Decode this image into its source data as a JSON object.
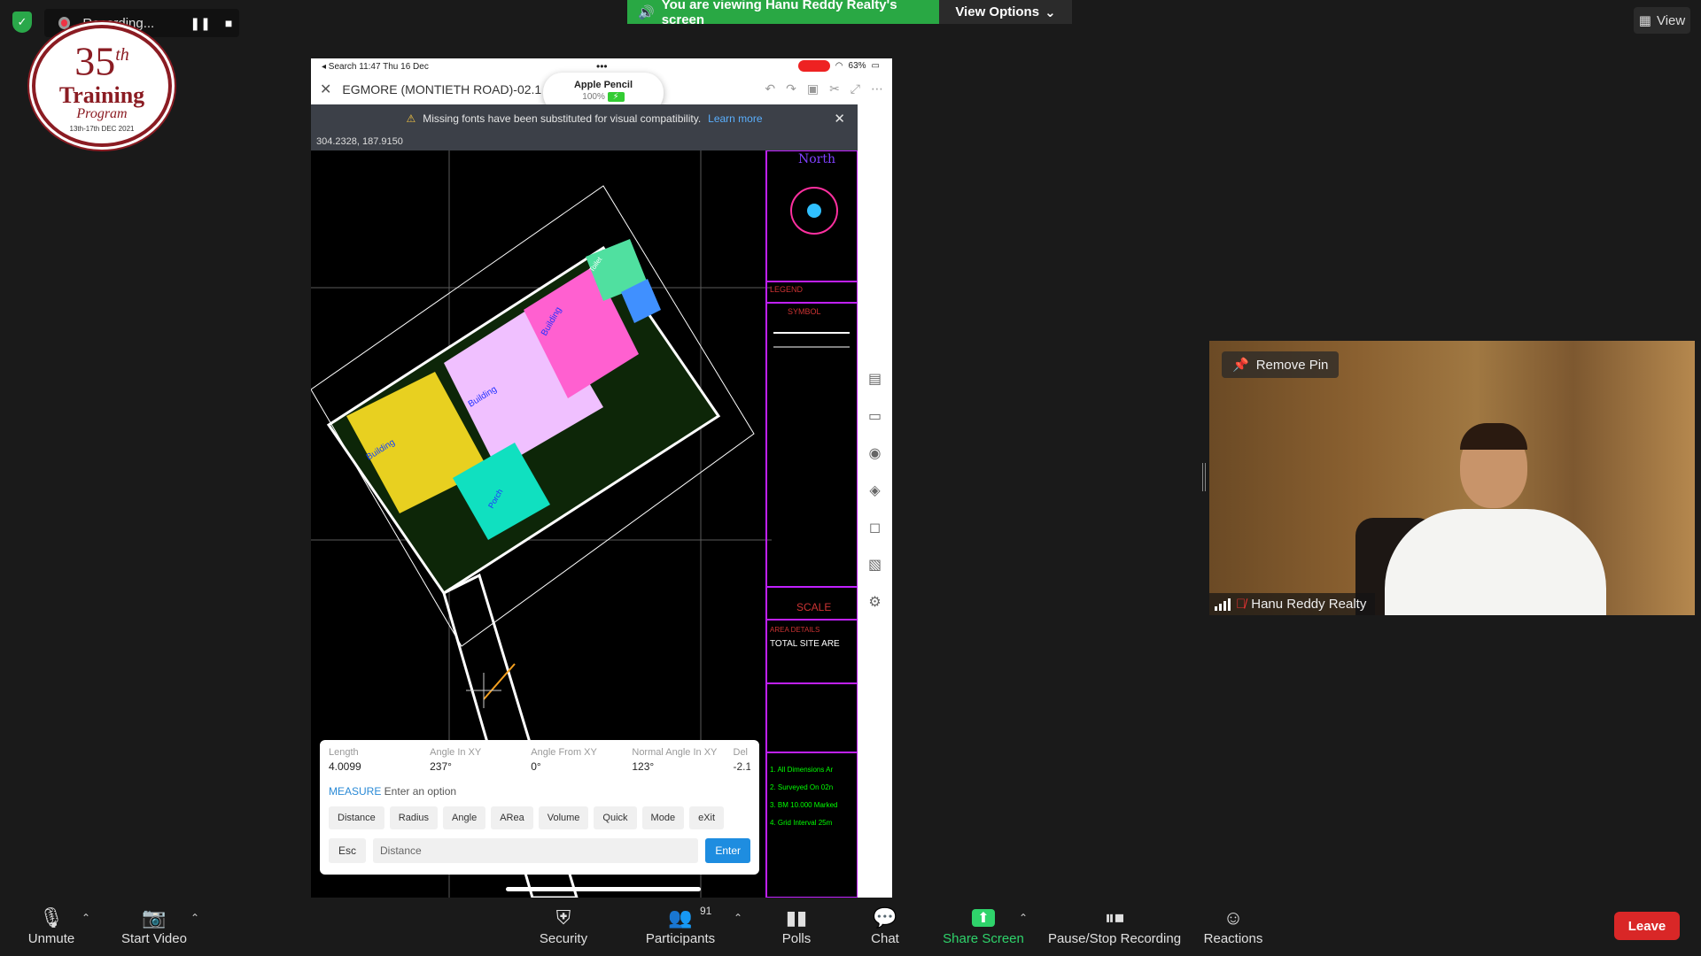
{
  "recording": {
    "label": "Recording...",
    "pause_icon": "pause-icon",
    "stop_icon": "stop-icon"
  },
  "banner": {
    "text": "You are viewing Hanu Reddy Realty's screen",
    "view_options": "View Options"
  },
  "view_button": {
    "label": "View"
  },
  "badge": {
    "number": "35",
    "suffix": "th",
    "title": "Training",
    "subtitle": "Program",
    "date": "13th-17th DEC 2021"
  },
  "ipad": {
    "status_left": "◂ Search  11:47   Thu 16 Dec",
    "status_dots": "•••",
    "battery": "63%",
    "file_title": "EGMORE (MONTIETH ROAD)-02.1",
    "pencil": {
      "title": "Apple Pencil",
      "pct": "100%"
    },
    "warning": "Missing fonts have been substituted for visual compatibility.",
    "learn_more": "Learn more",
    "coords": "304.2328, 187.9150",
    "measure": {
      "fields": [
        {
          "label": "Length",
          "value": "4.0099"
        },
        {
          "label": "Angle In XY",
          "value": "237°"
        },
        {
          "label": "Angle From XY",
          "value": "0°"
        },
        {
          "label": "Normal Angle In XY",
          "value": "123°"
        }
      ],
      "extra_label": "Del",
      "extra_value": "-2.1",
      "prompt_cmd": "MEASURE",
      "prompt_text": " Enter an option",
      "options": [
        "Distance",
        "Radius",
        "Angle",
        "ARea",
        "Volume",
        "Quick",
        "Mode",
        "eXit"
      ],
      "esc": "Esc",
      "input_placeholder": "Distance",
      "enter": "Enter"
    },
    "drawing_labels": {
      "north": "North",
      "legend": "LEGEND",
      "symbol": "SYMBOL",
      "scale": "SCALE",
      "area_details": "AREA DETAILS",
      "total_site": "TOTAL SITE ARE",
      "notes": [
        "1. All Dimensions Ar",
        "2. Surveyed On 02n",
        "3. BM 10.000 Marked",
        "4. Grid Interval 25m"
      ],
      "building": "Building",
      "toilet": "Toilet",
      "porch": "Porch"
    }
  },
  "video": {
    "remove_pin": "Remove Pin",
    "name": "Hanu Reddy Realty"
  },
  "toolbar": {
    "unmute": "Unmute",
    "start_video": "Start Video",
    "security": "Security",
    "participants": "Participants",
    "participants_count": "91",
    "polls": "Polls",
    "chat": "Chat",
    "share_screen": "Share Screen",
    "pause_stop": "Pause/Stop Recording",
    "reactions": "Reactions",
    "leave": "Leave"
  }
}
